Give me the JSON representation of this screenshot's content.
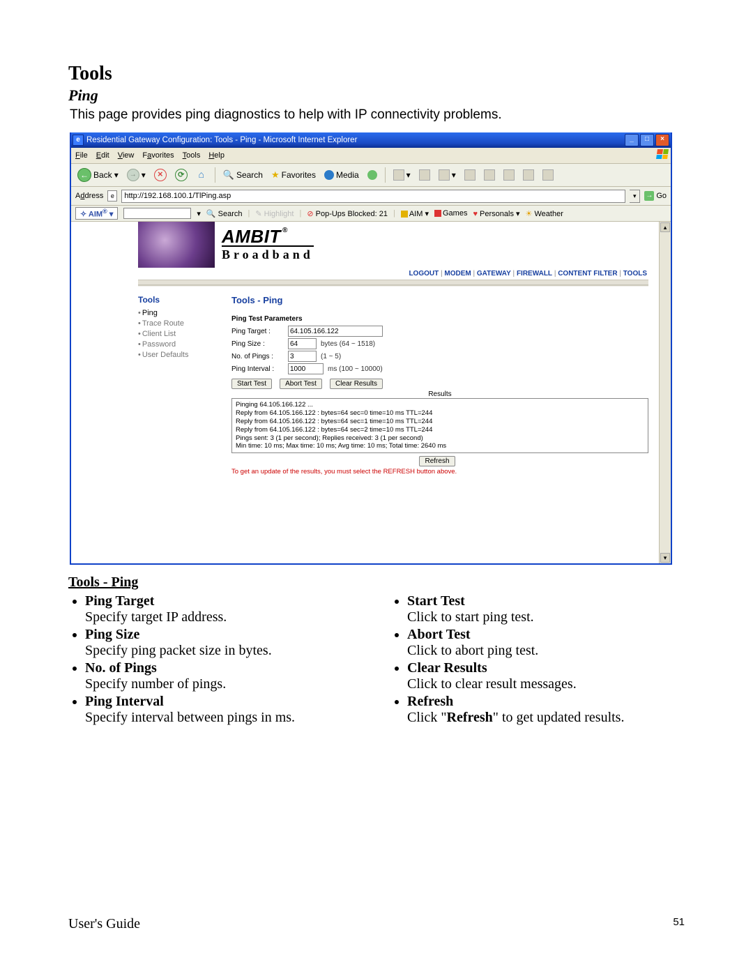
{
  "doc": {
    "section_title": "Tools",
    "subtitle": "Ping",
    "intro": "This page provides ping diagnostics to help with IP connectivity problems.",
    "footer_left": "User's Guide",
    "footer_right": "51",
    "desc_title": "Tools - Ping",
    "left_col": [
      {
        "term": "Ping Target",
        "def": "Specify target IP address."
      },
      {
        "term": "Ping Size",
        "def": "Specify ping packet size in bytes."
      },
      {
        "term": "No. of Pings",
        "def": "Specify number of pings."
      },
      {
        "term": "Ping Interval",
        "def": "Specify interval between pings in ms."
      }
    ],
    "right_col": [
      {
        "term": "Start Test",
        "def": "Click to start ping test."
      },
      {
        "term": "Abort Test",
        "def": "Click to abort ping test."
      },
      {
        "term": "Clear Results",
        "def": "Click to clear result messages."
      },
      {
        "term": "Refresh",
        "def_pre": "Click \"",
        "def_bold": "Refresh",
        "def_post": "\" to get updated results."
      }
    ]
  },
  "ie": {
    "title": "Residential Gateway Configuration: Tools - Ping - Microsoft Internet Explorer",
    "menu": {
      "file": "File",
      "edit": "Edit",
      "view": "View",
      "favorites": "Favorites",
      "tools": "Tools",
      "help": "Help"
    },
    "tb": {
      "back": "Back",
      "search": "Search",
      "favorites": "Favorites",
      "media": "Media"
    },
    "addr_label": "Address",
    "addr_value": "http://192.168.100.1/TlPing.asp",
    "go": "Go",
    "aim": {
      "logo": "AIM",
      "search": "Search",
      "highlight": "Highlight",
      "popups_label": "Pop-Ups Blocked:",
      "popups_count": "21",
      "aim": "AIM",
      "games": "Games",
      "personals": "Personals",
      "weather": "Weather"
    }
  },
  "rg": {
    "brand_top": "AMBIT",
    "brand_bottom": "Broadband",
    "topnav": [
      "LOGOUT",
      "MODEM",
      "GATEWAY",
      "FIREWALL",
      "CONTENT FILTER",
      "TOOLS"
    ],
    "side_title": "Tools",
    "side_items": [
      {
        "label": "Ping",
        "active": true
      },
      {
        "label": "Trace Route"
      },
      {
        "label": "Client List"
      },
      {
        "label": "Password"
      },
      {
        "label": "User Defaults"
      }
    ],
    "main_title": "Tools - Ping",
    "form_title": "Ping Test Parameters",
    "fields": {
      "target_label": "Ping Target :",
      "target_value": "64.105.166.122",
      "size_label": "Ping Size :",
      "size_value": "64",
      "size_hint": "bytes (64 ~ 1518)",
      "count_label": "No. of Pings :",
      "count_value": "3",
      "count_hint": "(1 ~ 5)",
      "interval_label": "Ping Interval :",
      "interval_value": "1000",
      "interval_hint": "ms (100 ~ 10000)"
    },
    "btn_start": "Start Test",
    "btn_abort": "Abort Test",
    "btn_clear": "Clear Results",
    "results_label": "Results",
    "results_text": "Pinging 64.105.166.122 ...\nReply from 64.105.166.122 : bytes=64 sec=0 time=10 ms TTL=244\nReply from 64.105.166.122 : bytes=64 sec=1 time=10 ms TTL=244\nReply from 64.105.166.122 : bytes=64 sec=2 time=10 ms TTL=244\nPings sent: 3 (1 per second); Replies received: 3 (1 per second)\nMin time: 10 ms; Max time: 10 ms; Avg time: 10 ms; Total time: 2640 ms",
    "btn_refresh": "Refresh",
    "note": "To get an update of the results, you must select the REFRESH button above."
  }
}
